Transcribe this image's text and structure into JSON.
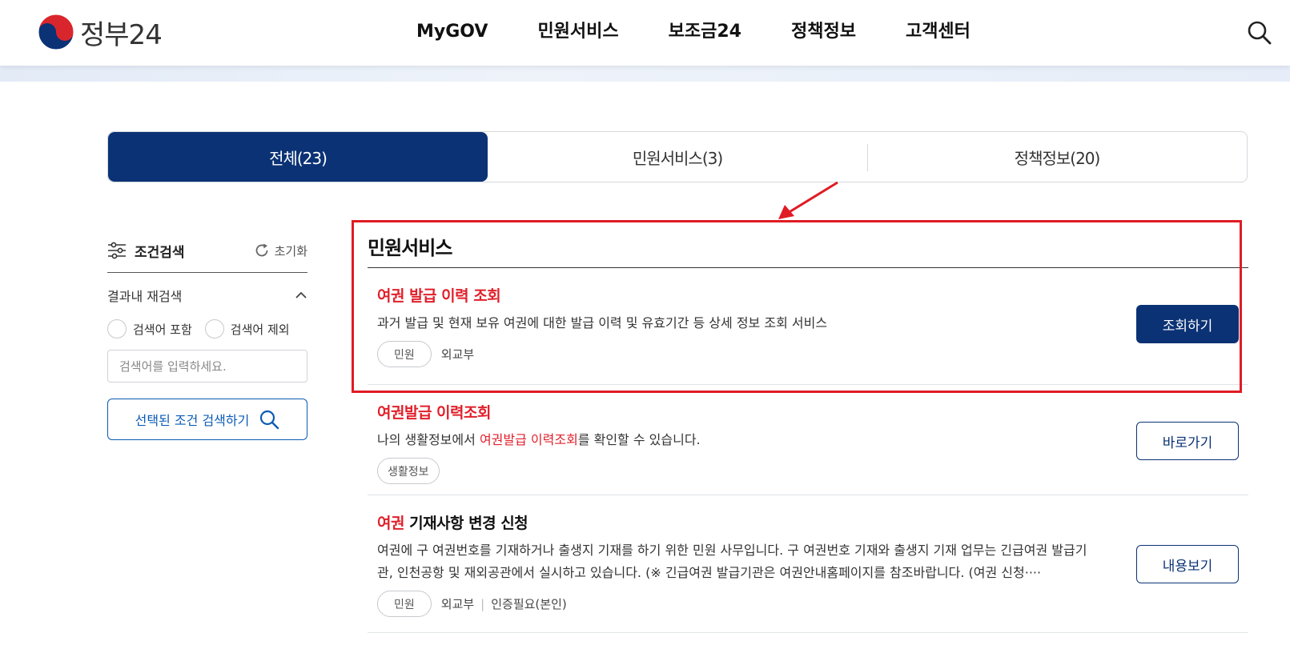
{
  "header": {
    "logo_text": "정부24",
    "nav": [
      "MyGOV",
      "민원서비스",
      "보조금24",
      "정책정보",
      "고객센터"
    ]
  },
  "tabs": [
    {
      "label": "전체(23)",
      "active": true
    },
    {
      "label": "민원서비스(3)",
      "active": false
    },
    {
      "label": "정책정보(20)",
      "active": false
    }
  ],
  "filter": {
    "title": "조건검색",
    "reset_label": "초기화",
    "re_search_label": "결과내 재검색",
    "include_label": "검색어 포함",
    "exclude_label": "검색어 제외",
    "input_placeholder": "검색어를 입력하세요.",
    "submit_label": "선택된 조건 검색하기"
  },
  "results": {
    "section_title": "민원서비스",
    "items": [
      {
        "title_hl": "여권 발급 이력 조회",
        "title_rest": "",
        "desc": "과거 발급 및 현재 보유 여권에 대한 발급 이력 및 유효기간 등 상세 정보 조회 서비스",
        "badge": "민원",
        "agency": "외교부",
        "extra": "",
        "button": "조회하기"
      },
      {
        "title_hl": "여권발급 이력조회",
        "title_rest": "",
        "desc_pre": "나의 생활정보에서 ",
        "desc_hl": "여권발급 이력조회",
        "desc_post": "를 확인할 수 있습니다.",
        "badge": "생활정보",
        "button": "바로가기"
      },
      {
        "title_hl": "여권",
        "title_rest": " 기재사항 변경 신청",
        "desc": "여권에 구 여권번호를 기재하거나 출생지 기재를 하기 위한 민원 사무입니다. 구 여권번호 기재와 출생지 기재 업무는 긴급여권 발급기관, 인천공항 및 재외공관에서 실시하고 있습니다. (※ 긴급여권 발급기관은 여권안내홈페이지를 참조바랍니다. (여권 신청····",
        "badge": "민원",
        "agency": "외교부",
        "extra": "인증필요(본인)",
        "button": "내용보기"
      }
    ]
  },
  "colors": {
    "primary": "#0b3275",
    "highlight": "#e0202b",
    "annotation": "#e01b24"
  }
}
